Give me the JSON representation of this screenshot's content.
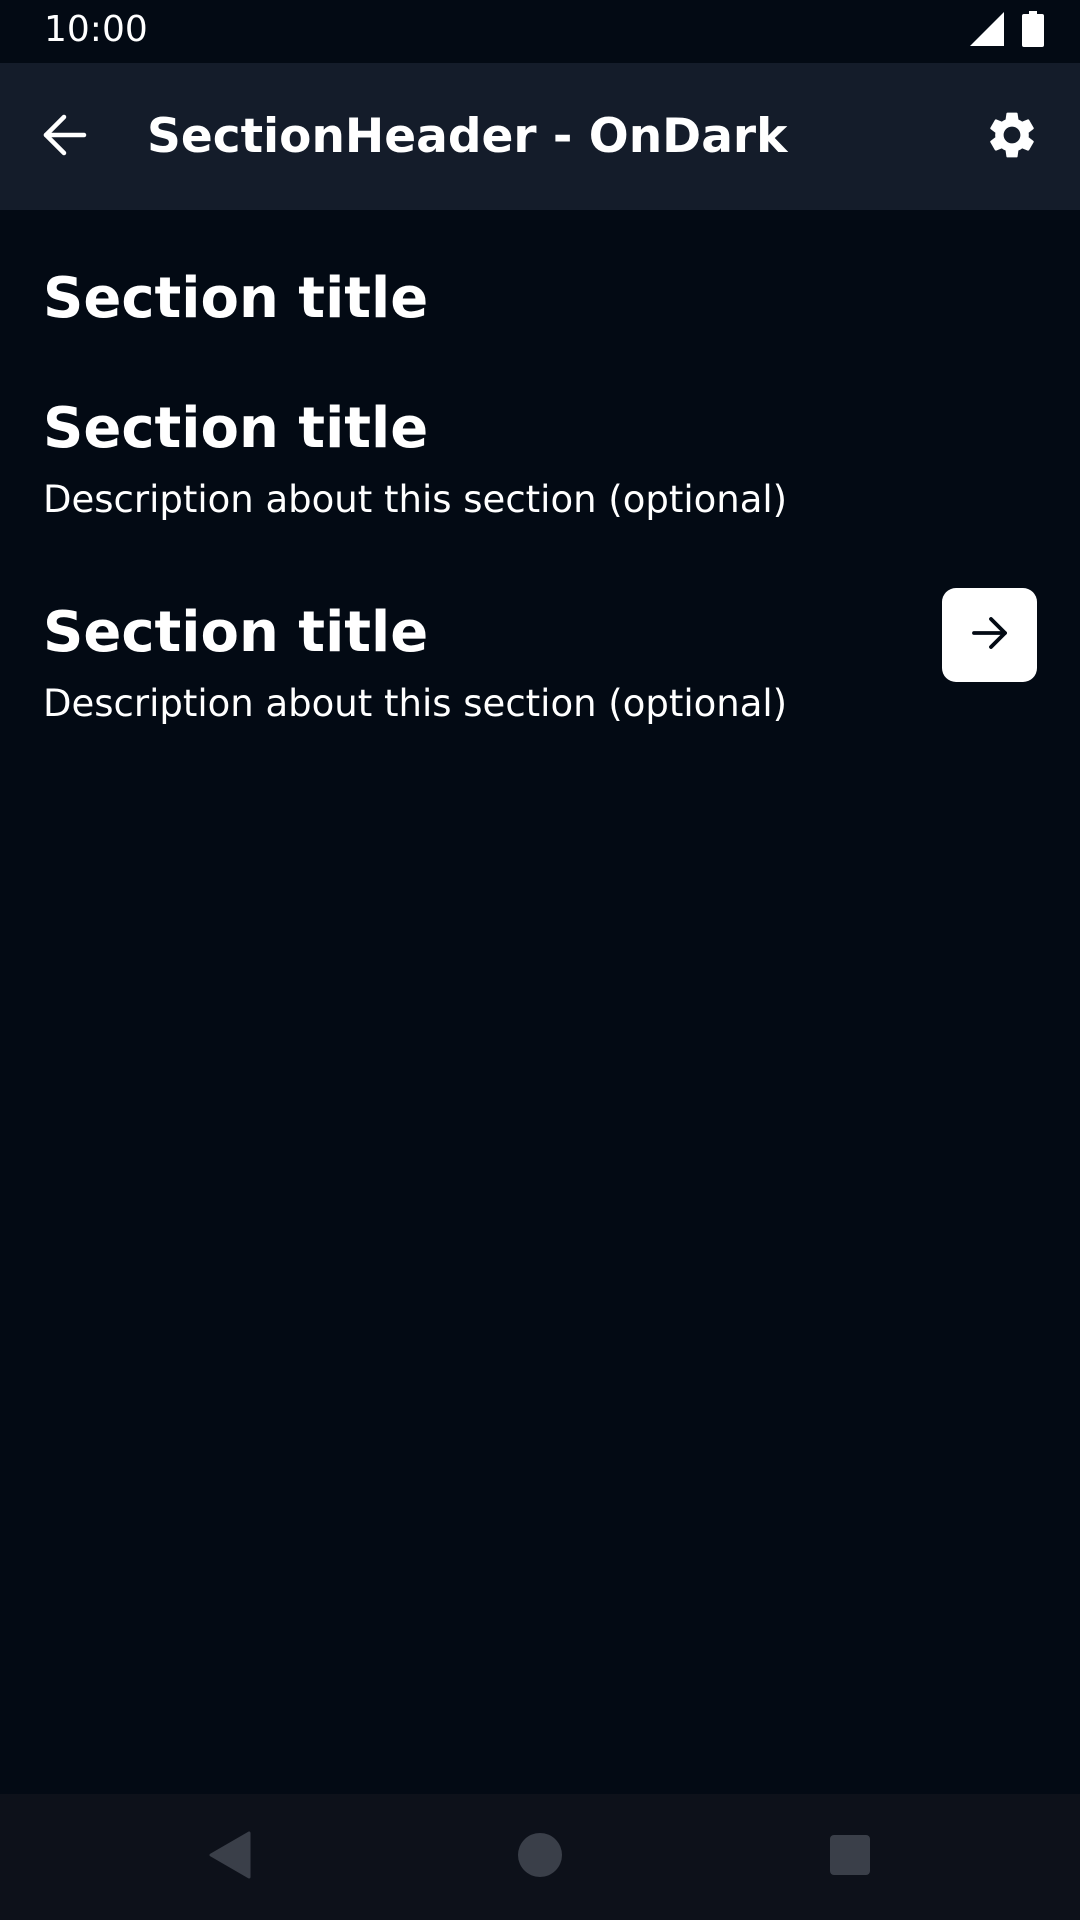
{
  "status_bar": {
    "time": "10:00",
    "icons": [
      "cellular-signal-icon",
      "battery-icon"
    ]
  },
  "app_bar": {
    "title": "SectionHeader - OnDark",
    "back_icon": "arrow-back-icon",
    "settings_icon": "gear-icon"
  },
  "sections": [
    {
      "title": "Section title"
    },
    {
      "title": "Section title",
      "description": "Description about this section (optional)"
    },
    {
      "title": "Section title",
      "description": "Description about this section (optional)",
      "action_icon": "arrow-forward-icon"
    }
  ],
  "nav_bar": {
    "icons": [
      "nav-back-triangle-icon",
      "nav-home-circle-icon",
      "nav-recents-square-icon"
    ]
  },
  "colors": {
    "background": "#030a14",
    "app_bar": "#141c2a",
    "nav_bar": "#0d111a",
    "text": "#ffffff",
    "nav_icons": "#3a3f49"
  }
}
